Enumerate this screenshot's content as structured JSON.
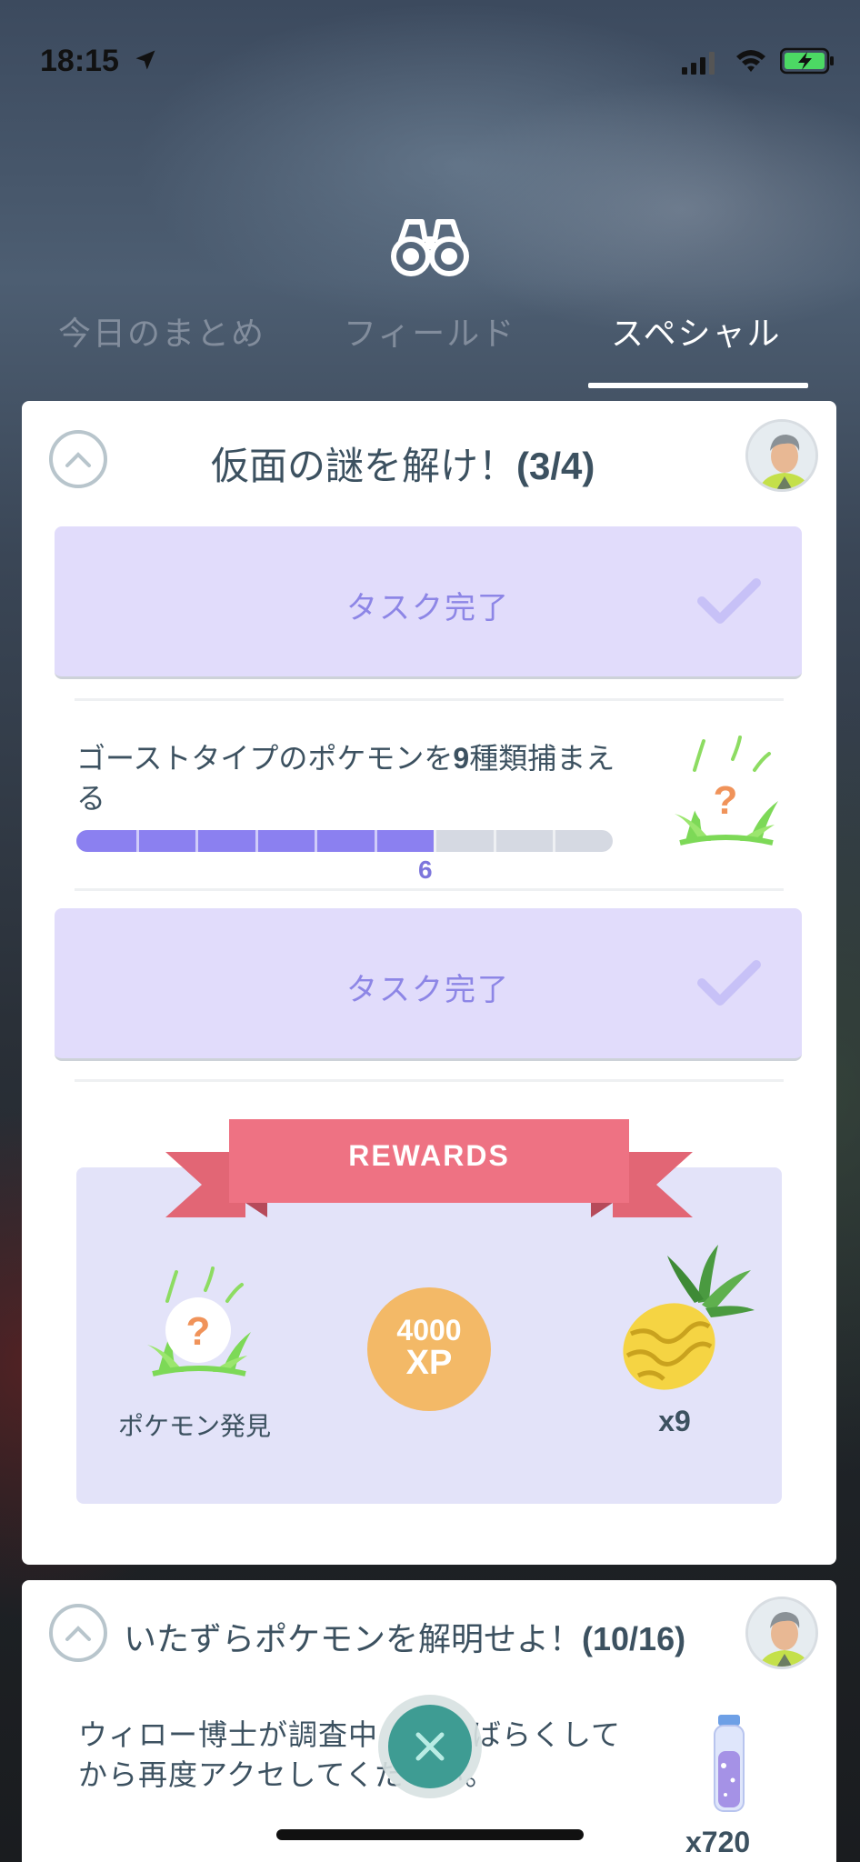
{
  "status_bar": {
    "time": "18:15",
    "icons": [
      "location-arrow-icon",
      "cellular-signal-icon",
      "wifi-icon",
      "battery-charging-icon"
    ]
  },
  "header": {
    "icon": "binoculars-icon",
    "tabs": [
      {
        "label": "今日のまとめ",
        "active": false
      },
      {
        "label": "フィールド",
        "active": false
      },
      {
        "label": "スペシャル",
        "active": true
      }
    ]
  },
  "research_card": {
    "title": "仮面の謎を解け！",
    "step": "(3/4)",
    "tasks": [
      {
        "status": "タスク完了"
      },
      {
        "text_a": "ゴーストタイプのポケモンを",
        "text_num": "9",
        "text_b": "種類捕まえる",
        "progress_current": 6,
        "progress_total": 9,
        "reward_icon": "pokemon-encounter-icon"
      },
      {
        "status": "タスク完了"
      }
    ],
    "rewards_title": "REWARDS",
    "rewards": [
      {
        "icon": "pokemon-encounter-icon",
        "label": "ポケモン発見"
      },
      {
        "amount": "4000",
        "unit": "XP"
      },
      {
        "icon": "golden-pinap-berry-icon",
        "label": "x9"
      }
    ]
  },
  "second_card": {
    "title": "いたずらポケモンを解明せよ！",
    "step": "(10/16)",
    "message_a": "ウィロー博士が調査中",
    "message_b": "しばらくしてから再度アクセ",
    "message_c": "してください。",
    "reward_icon": "stardust-vial-icon",
    "reward_count": "x720"
  },
  "colors": {
    "accent_purple": "#8b80f0",
    "task_done_bg": "#e1dcfb",
    "ribbon": "#e8697a",
    "xp": "#f3b967",
    "fab": "#3e9c93"
  }
}
